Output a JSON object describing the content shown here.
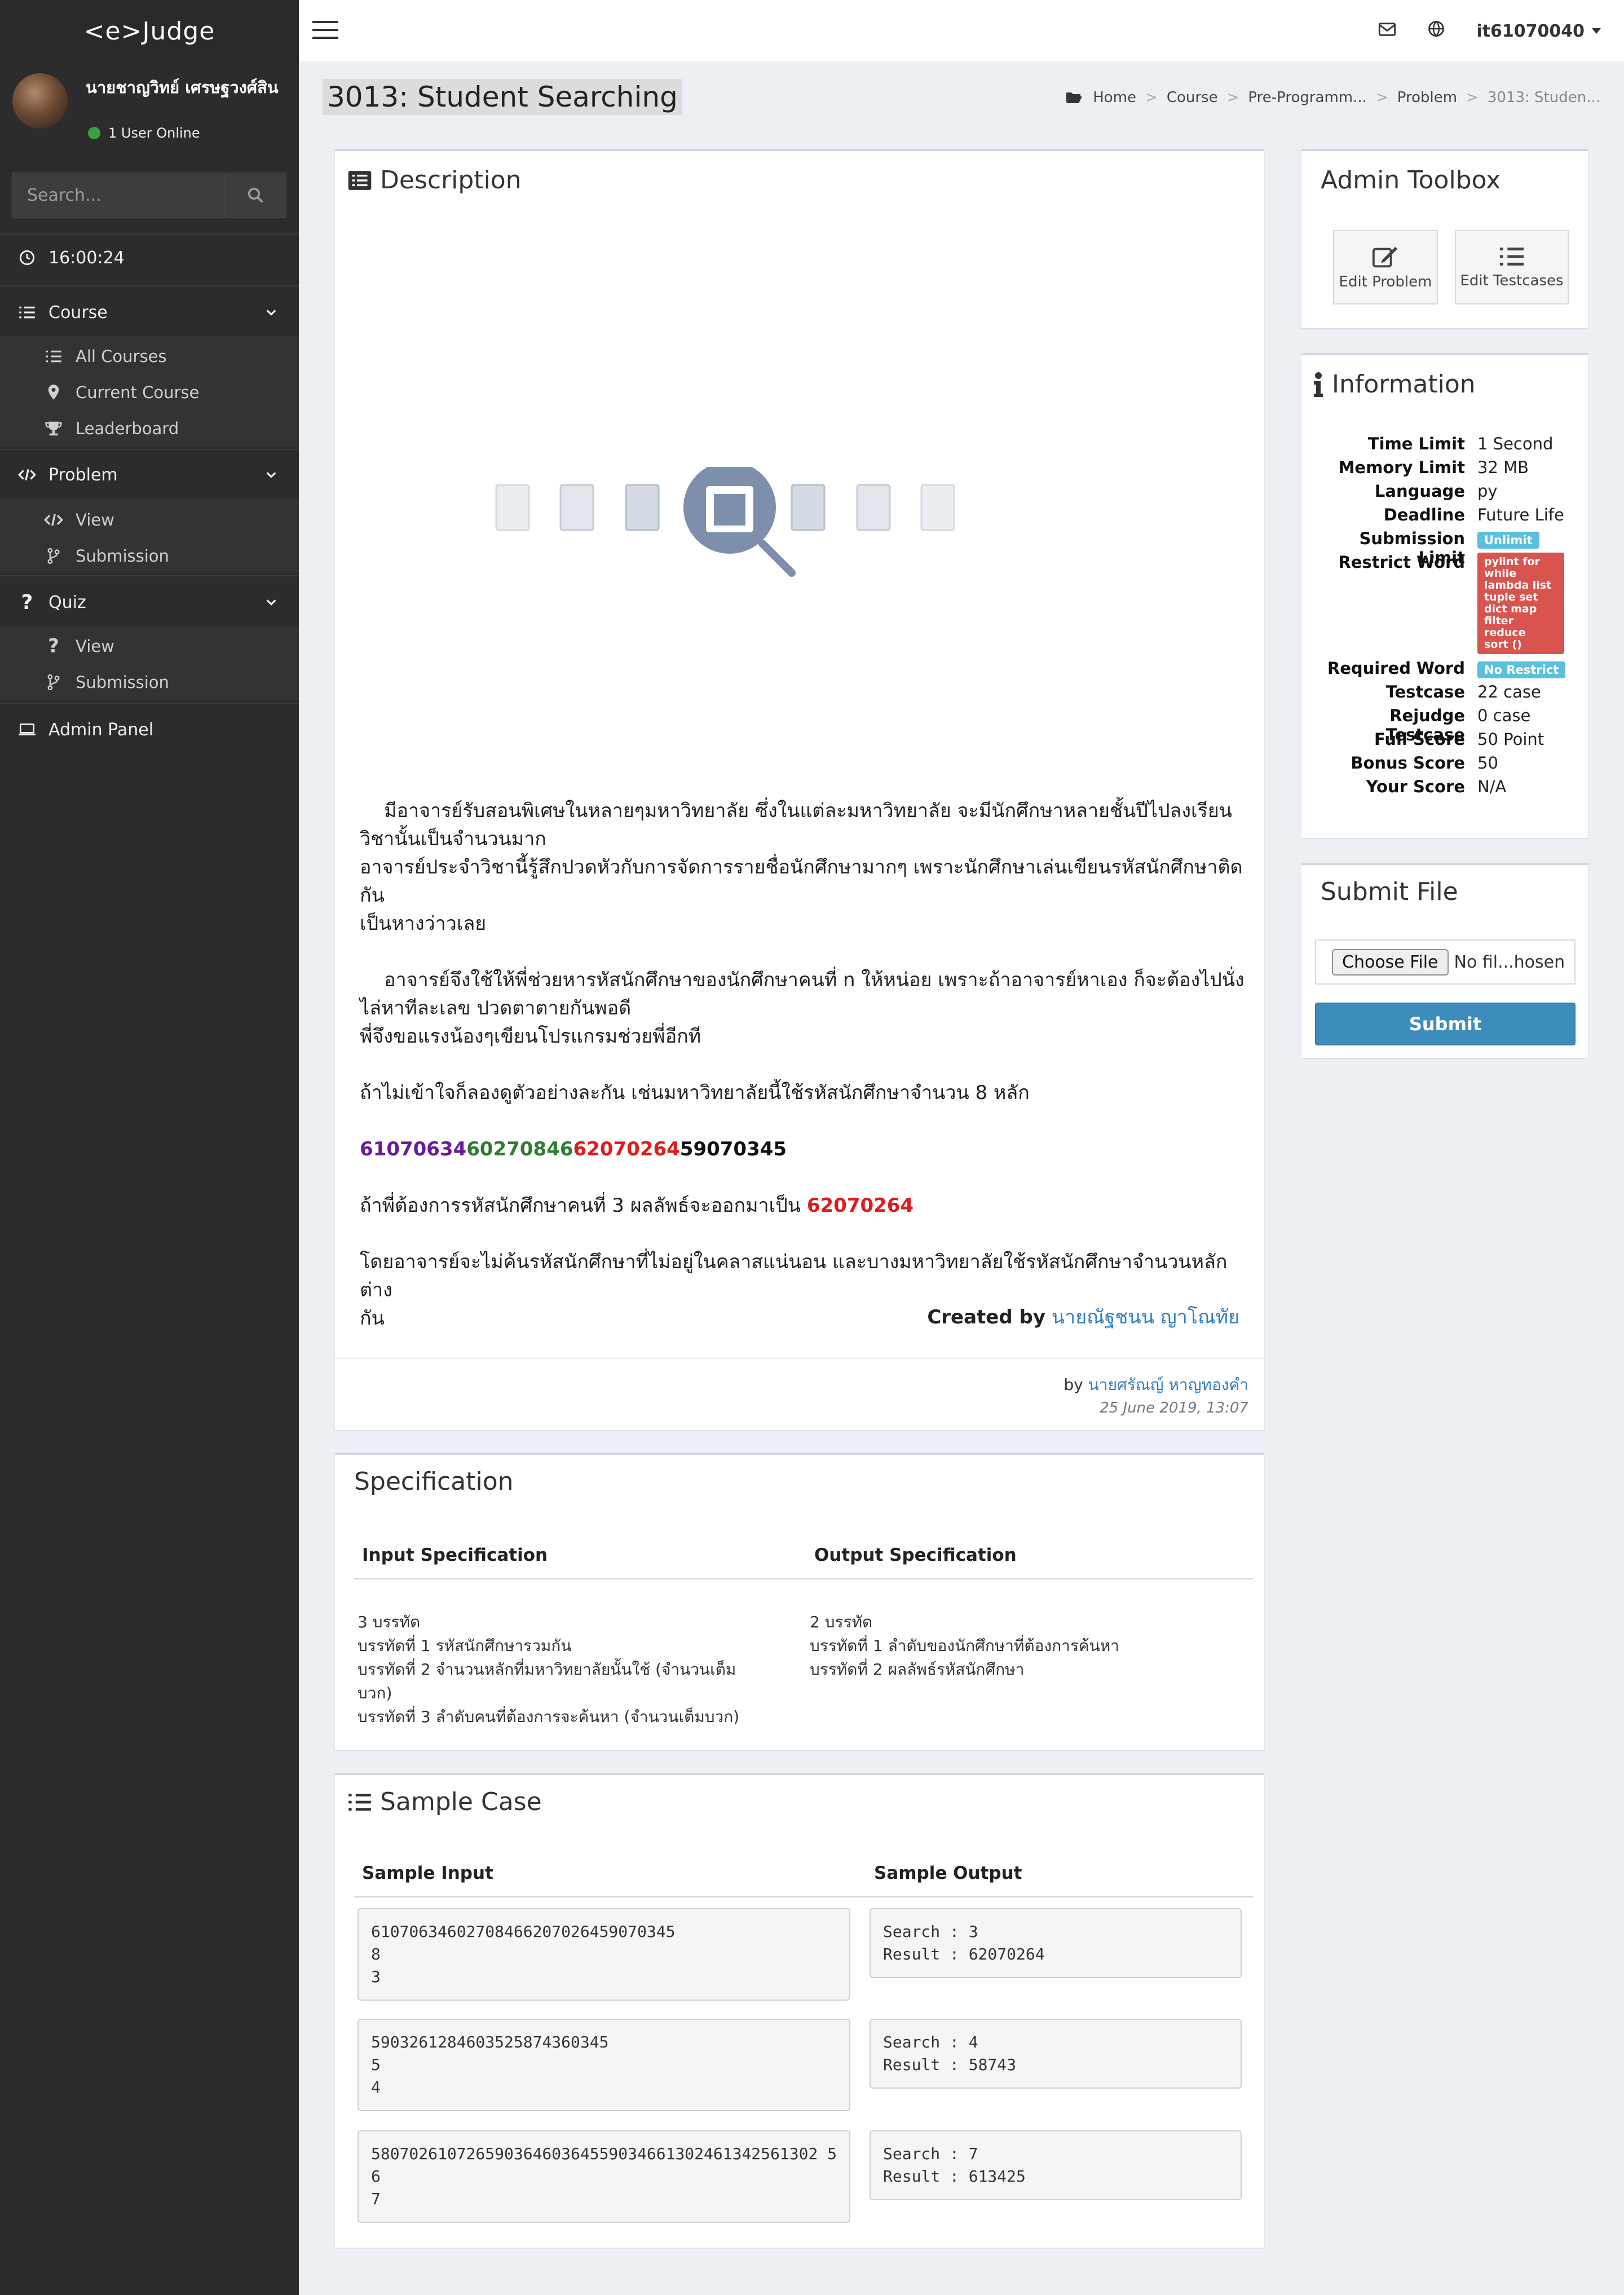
{
  "app": {
    "logo": "<e>Judge"
  },
  "user": {
    "name": "นายชาญวิทย์ เศรษฐวงศ์สิน",
    "status": "1 User Online"
  },
  "sidebar": {
    "search_placeholder": "Search...",
    "clock": "16:00:24",
    "sections": [
      {
        "label": "Course",
        "items": [
          "All Courses",
          "Current Course",
          "Leaderboard"
        ]
      },
      {
        "label": "Problem",
        "items": [
          "View",
          "Submission"
        ]
      },
      {
        "label": "Quiz",
        "items": [
          "View",
          "Submission"
        ]
      }
    ],
    "admin_panel": "Admin Panel"
  },
  "topbar": {
    "username": "it61070040"
  },
  "page": {
    "title": "3013: Student Searching",
    "breadcrumb": [
      "Home",
      "Course",
      "Pre-Programm...",
      "Problem",
      "3013: Studen..."
    ]
  },
  "description": {
    "title": "Description",
    "p1_line1": "    มีอาจารย์รับสอนพิเศษในหลายๆมหาวิทยาลัย ซึ่งในแต่ละมหาวิทยาลัย จะมีนักศึกษาหลายชั้นปีไปลงเรียน",
    "p1_line2": "วิชานั้นเป็นจำนวนมาก",
    "p1_line3": "อาจารย์ประจำวิชานี้รู้สึกปวดหัวกับการจัดการรายชื่อนักศึกษามากๆ เพราะนักศึกษาเล่นเขียนรหัสนักศึกษาติดกัน",
    "p1_line4": "เป็นหางว่าวเลย",
    "p2_line1": "    อาจารย์จึงใช้ให้พี่ช่วยหารหัสนักศึกษาของนักศึกษาคนที่ n ให้หน่อย เพราะถ้าอาจารย์หาเอง ก็จะต้องไปนั่ง",
    "p2_line2": "ไล่หาทีละเลข ปวดตาตายกันพอดี",
    "p2_line3": "พี่จึงขอแรงน้องๆเขียนโปรแกรมช่วยพี่อีกที",
    "p3": "ถ้าไม่เข้าใจก็ลองดูตัวอย่างละกัน เช่นมหาวิทยาลัยนี้ใช้รหัสนักศึกษาจำนวน 8 หลัก",
    "codes": [
      "61070634",
      "60270846",
      "62070264",
      "59070345"
    ],
    "p4_text": "ถ้าพี่ต้องการรหัสนักศึกษาคนที่ 3 ผลลัพธ์จะออกมาเป็น",
    "p4_code": "62070264",
    "p5_line1": "โดยอาจารย์จะไม่ค้นรหัสนักศึกษาที่ไม่อยู่ในคลาสแน่นอน และบางมหาวิทยาลัยใช้รหัสนักศึกษาจำนวนหลักต่าง",
    "p5_line2": "กัน",
    "created_by_label": "Created by",
    "created_by_name": "นายณัฐชนน ญาโณทัย",
    "by_label": "by",
    "by_name": "นายศรัณญ์ หาญทองคำ",
    "date": "25 June 2019, 13:07"
  },
  "specification": {
    "title": "Specification",
    "input_header": "Input Specification",
    "output_header": "Output Specification",
    "input_lines": [
      "3 บรรทัด",
      "บรรทัดที่ 1 รหัสนักศึกษารวมกัน",
      "บรรทัดที่ 2 จำนวนหลักที่มหาวิทยาลัยนั้นใช้ (จำนวนเต็ม",
      "บวก)",
      "บรรทัดที่ 3 ลำดับคนที่ต้องการจะค้นหา (จำนวนเต็มบวก)"
    ],
    "output_lines": [
      "2 บรรทัด",
      "บรรทัดที่ 1 ลำดับของนักศึกษาที่ต้องการค้นหา",
      "บรรทัดที่ 2 ผลลัพธ์รหัสนักศึกษา"
    ]
  },
  "sample": {
    "title": "Sample Case",
    "input_header": "Sample Input",
    "output_header": "Sample Output",
    "cases": [
      {
        "input": "61070634602708466207026459070345\n8\n3",
        "output": "Search : 3\nResult : 62070264"
      },
      {
        "input": "5903261284603525874360345\n5\n4",
        "output": "Search : 4\nResult : 58743"
      },
      {
        "input": "58070261072659036460364559034661302461342561302 5\n6\n7",
        "output": "Search : 7\nResult : 613425"
      }
    ]
  },
  "toolbox": {
    "title": "Admin Toolbox",
    "edit_problem": "Edit Problem",
    "edit_testcases": "Edit Testcases"
  },
  "information": {
    "title": "Information",
    "time_limit_k": "Time Limit",
    "time_limit_v": "1 Second",
    "memory_limit_k": "Memory Limit",
    "memory_limit_v": "32 MB",
    "language_k": "Language",
    "language_v": "py",
    "deadline_k": "Deadline",
    "deadline_v": "Future Life",
    "submission_limit_k": "Submission Limit",
    "submission_limit_v": "Unlimit",
    "restrict_word_k": "Restrict Word",
    "restrict_words": [
      "pylint for",
      "while",
      "lambda list",
      "tuple set",
      "dict map",
      "filter",
      "reduce",
      "sort ()"
    ],
    "required_word_k": "Required Word",
    "required_word_v": "No Restrict",
    "testcase_k": "Testcase",
    "testcase_v": "22 case",
    "rejudge_k": "Rejudge Testcase",
    "rejudge_v": "0 case",
    "full_score_k": "Full Score",
    "full_score_v": "50 Point",
    "bonus_score_k": "Bonus Score",
    "bonus_score_v": "50",
    "your_score_k": "Your Score",
    "your_score_v": "N/A"
  },
  "submit": {
    "title": "Submit File",
    "choose_label": "Choose File",
    "file_status": "No fil...hosen",
    "submit_label": "Submit"
  }
}
